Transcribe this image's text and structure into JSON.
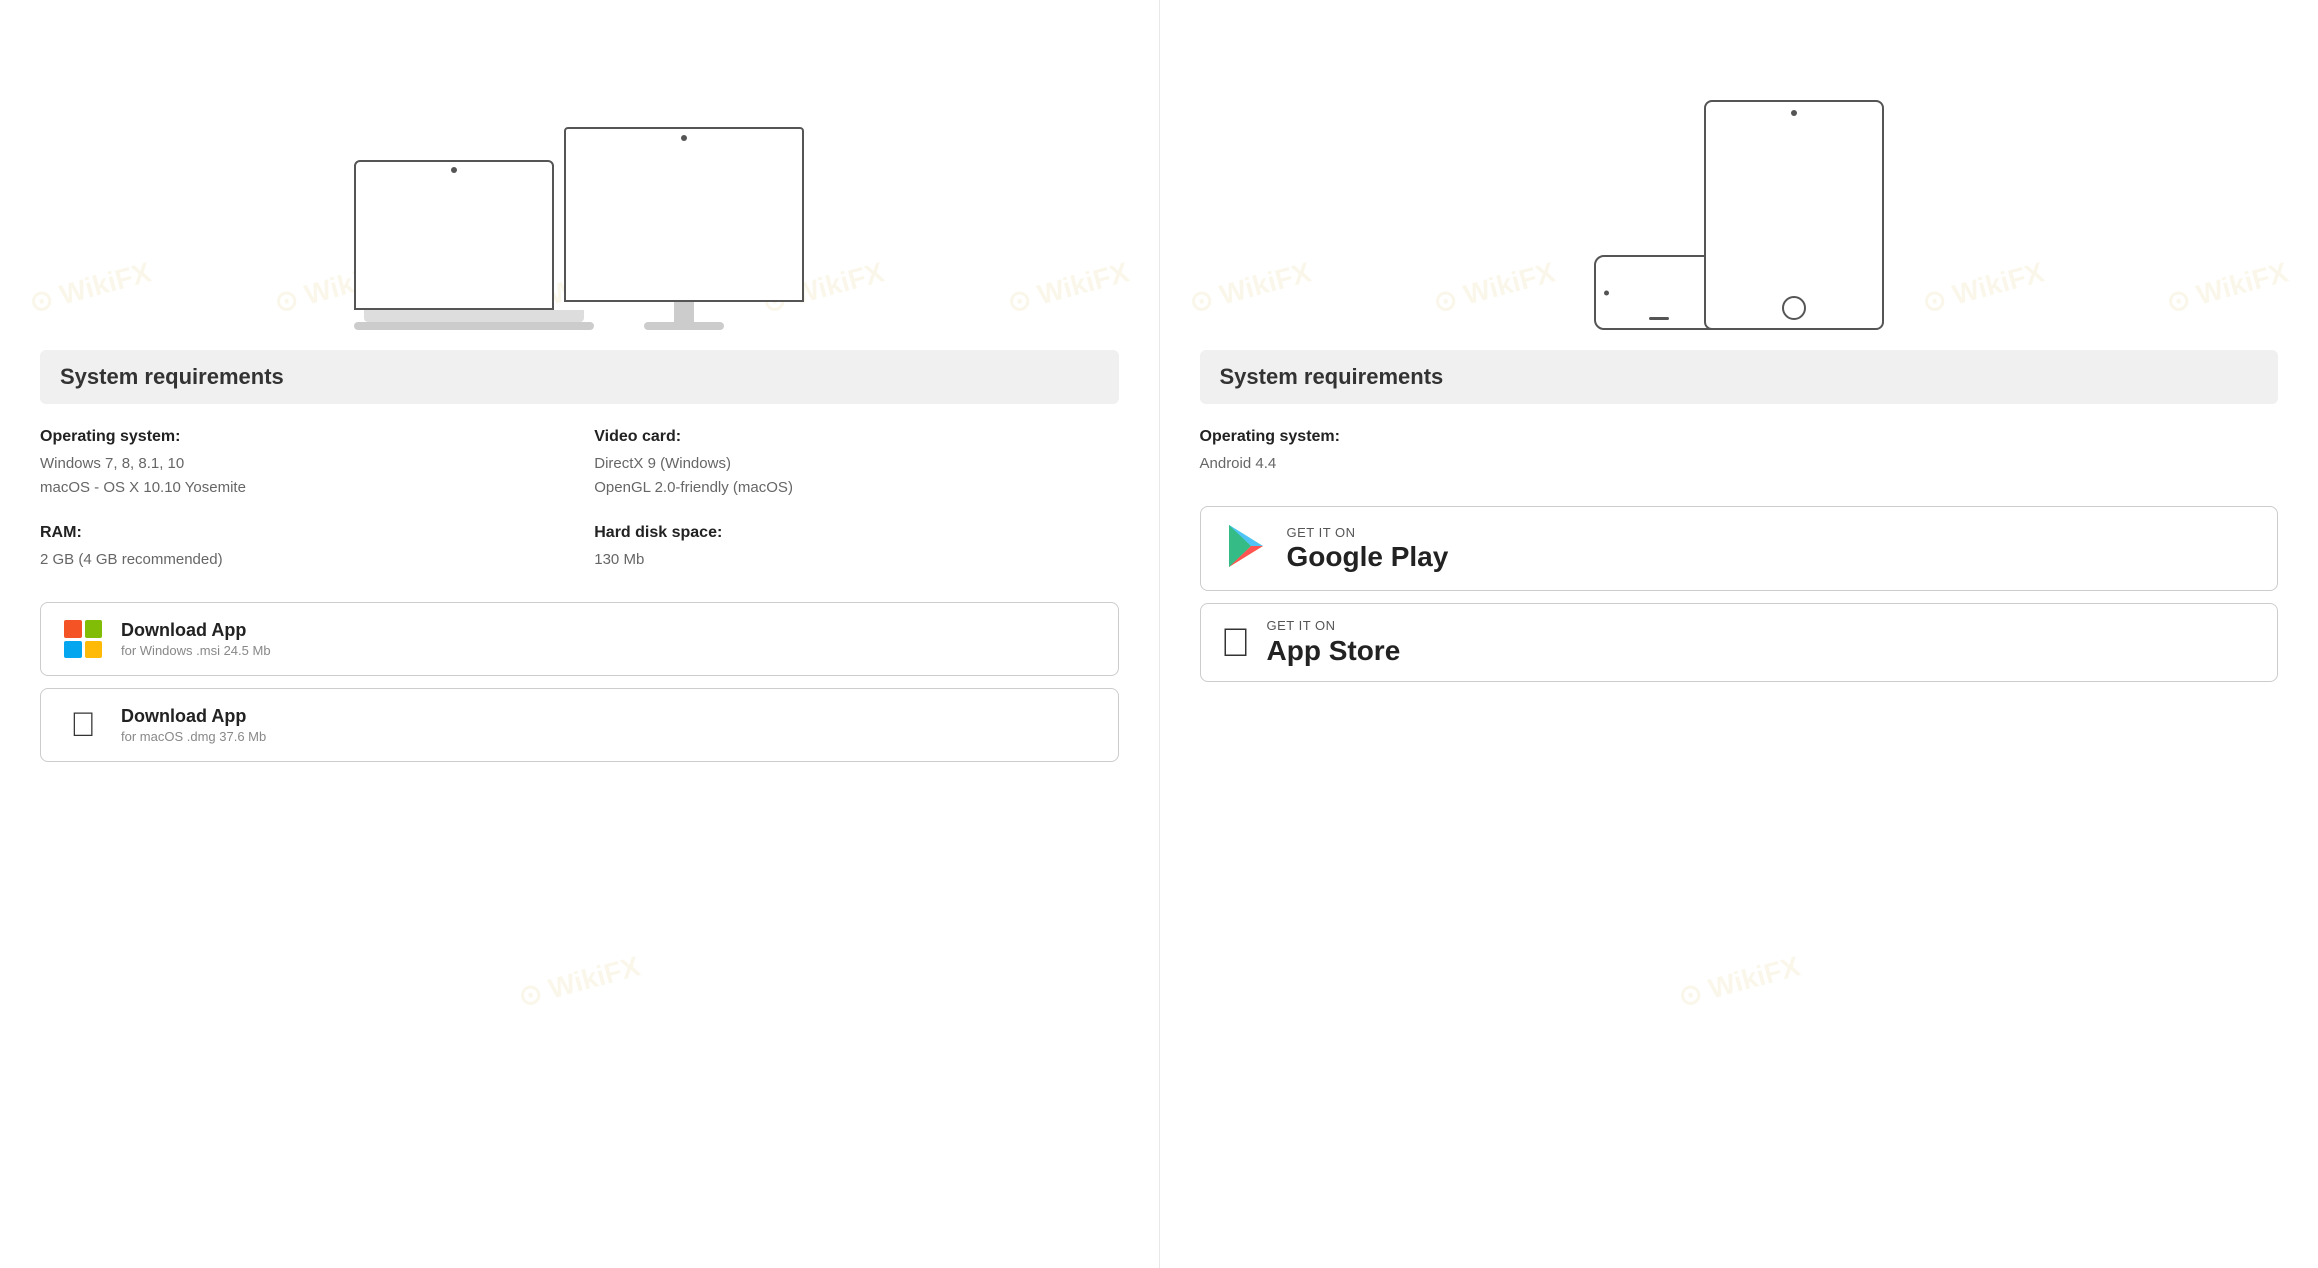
{
  "left_panel": {
    "sys_req_title": "System requirements",
    "os_label": "Operating system:",
    "os_value_1": "Windows 7, 8, 8.1, 10",
    "os_value_2": "macOS - OS X 10.10 Yosemite",
    "video_card_label": "Video card:",
    "video_card_value_1": "DirectX 9 (Windows)",
    "video_card_value_2": "OpenGL 2.0-friendly (macOS)",
    "ram_label": "RAM:",
    "ram_value": "2 GB (4 GB recommended)",
    "hard_disk_label": "Hard disk space:",
    "hard_disk_value": "130 Mb",
    "btn_windows_title": "Download App",
    "btn_windows_subtitle": "for Windows .msi 24.5 Mb",
    "btn_mac_title": "Download App",
    "btn_mac_subtitle": "for macOS .dmg 37.6 Mb"
  },
  "right_panel": {
    "sys_req_title": "System requirements",
    "os_label": "Operating system:",
    "os_value": "Android 4.4",
    "google_play_small": "GET IT ON",
    "google_play_big": "Google Play",
    "app_store_small": "GET IT ON",
    "app_store_big": "App Store"
  },
  "watermark": "WikiFX"
}
